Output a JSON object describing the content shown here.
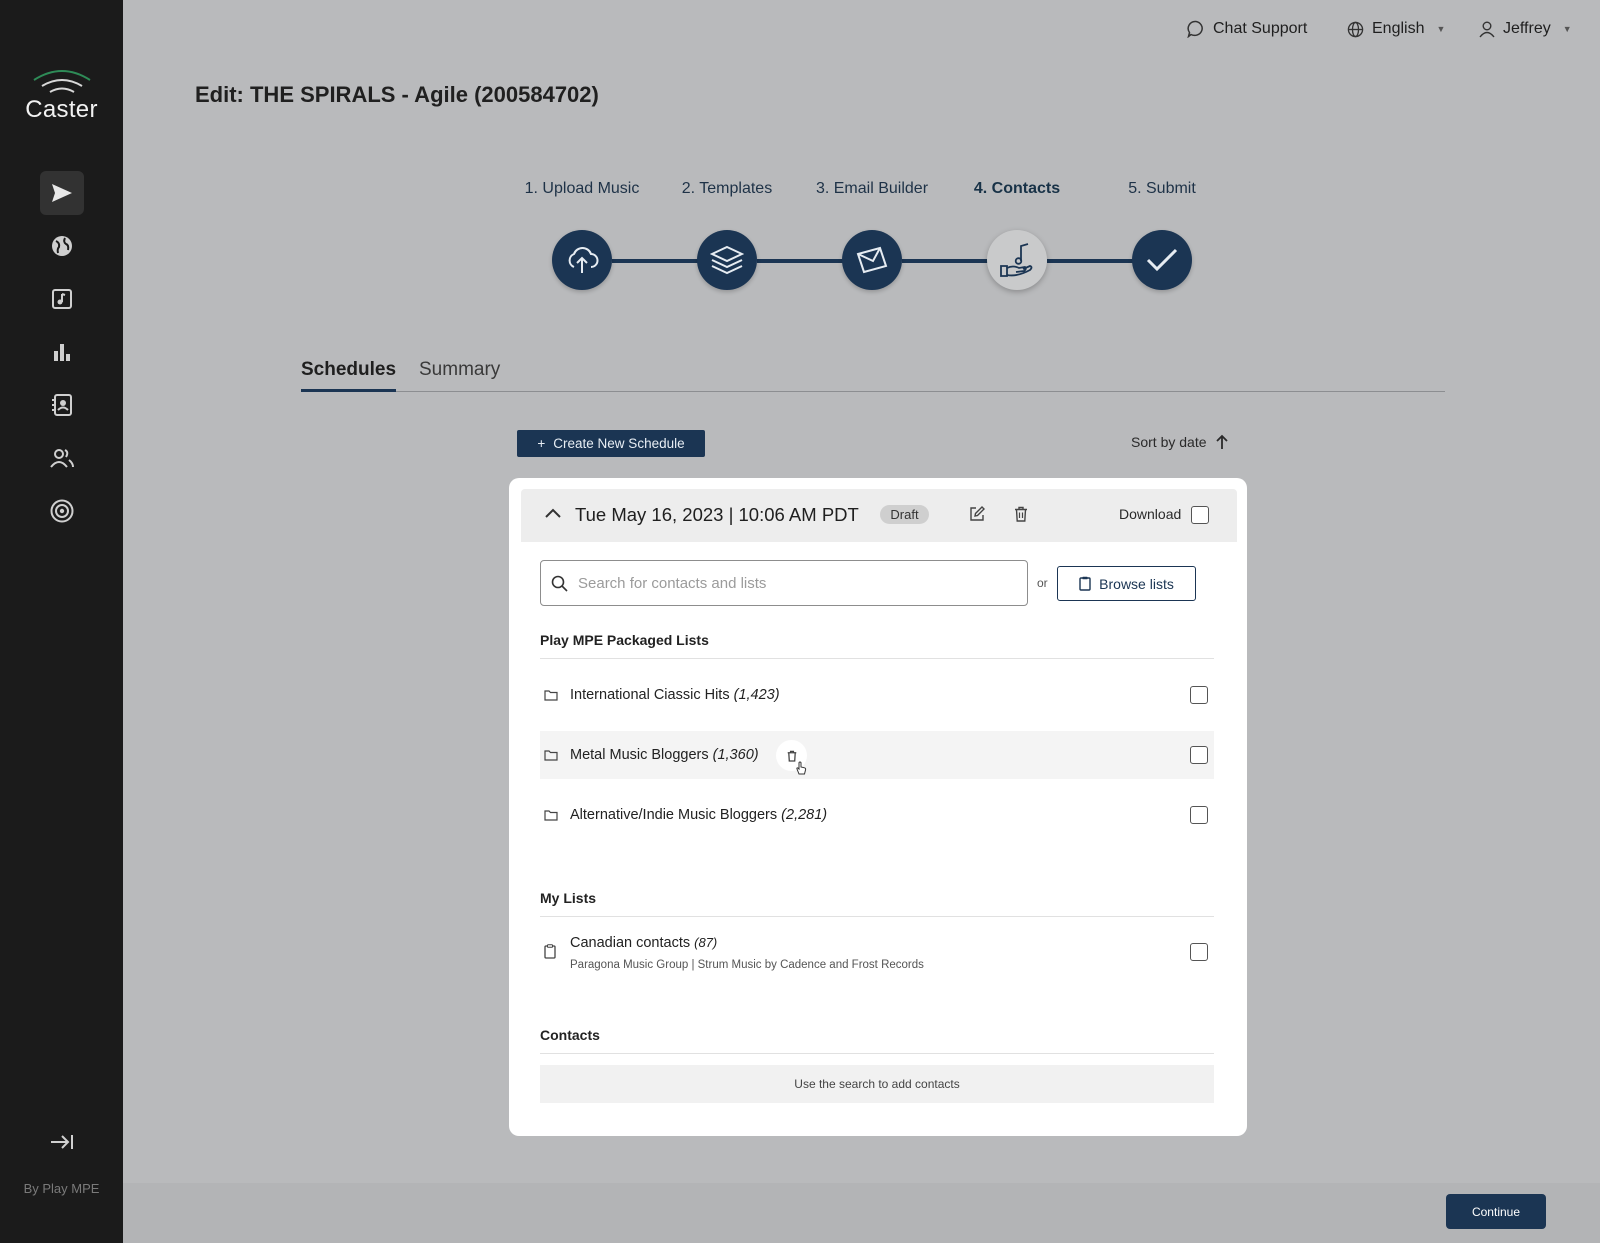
{
  "app": {
    "name": "Caster",
    "footer": "By Play MPE"
  },
  "topbar": {
    "chat": "Chat Support",
    "language": "English",
    "user": "Jeffrey"
  },
  "page_title": "Edit: THE SPIRALS - Agile (200584702)",
  "steps": [
    {
      "label": "1. Upload Music",
      "icon": "cloud-upload-icon"
    },
    {
      "label": "2. Templates",
      "icon": "layers-icon"
    },
    {
      "label": "3. Email Builder",
      "icon": "envelope-icon"
    },
    {
      "label": "4. Contacts",
      "icon": "hand-music-icon",
      "current": true
    },
    {
      "label": "5. Submit",
      "icon": "checkmark-icon"
    }
  ],
  "tabs": {
    "schedules": "Schedules",
    "summary": "Summary"
  },
  "actions": {
    "create": "Create New Schedule",
    "sort": "Sort by date"
  },
  "schedule": {
    "date": "Tue May 16, 2023 | 10:06 AM PDT",
    "status": "Draft",
    "download_label": "Download",
    "search_placeholder": "Search for contacts and lists",
    "or": "or",
    "browse": "Browse lists"
  },
  "packaged": {
    "title": "Play MPE Packaged Lists",
    "items": [
      {
        "name": "International Ciassic Hits",
        "count": "(1,423)"
      },
      {
        "name": "Metal Music Bloggers",
        "count": "(1,360)"
      },
      {
        "name": "Alternative/Indie Music Bloggers",
        "count": "(2,281)"
      }
    ]
  },
  "my_lists": {
    "title": "My Lists",
    "items": [
      {
        "name": "Canadian contacts",
        "count": "(87)",
        "sub": "Paragona Music Group | Strum Music by Cadence and Frost Records"
      }
    ]
  },
  "contacts": {
    "title": "Contacts",
    "empty": "Use the search to add contacts"
  },
  "footer": {
    "continue": "Continue"
  },
  "colors": {
    "primary": "#1b3553",
    "sidebar": "#1b1b1b",
    "overlay": "#b9babc"
  }
}
